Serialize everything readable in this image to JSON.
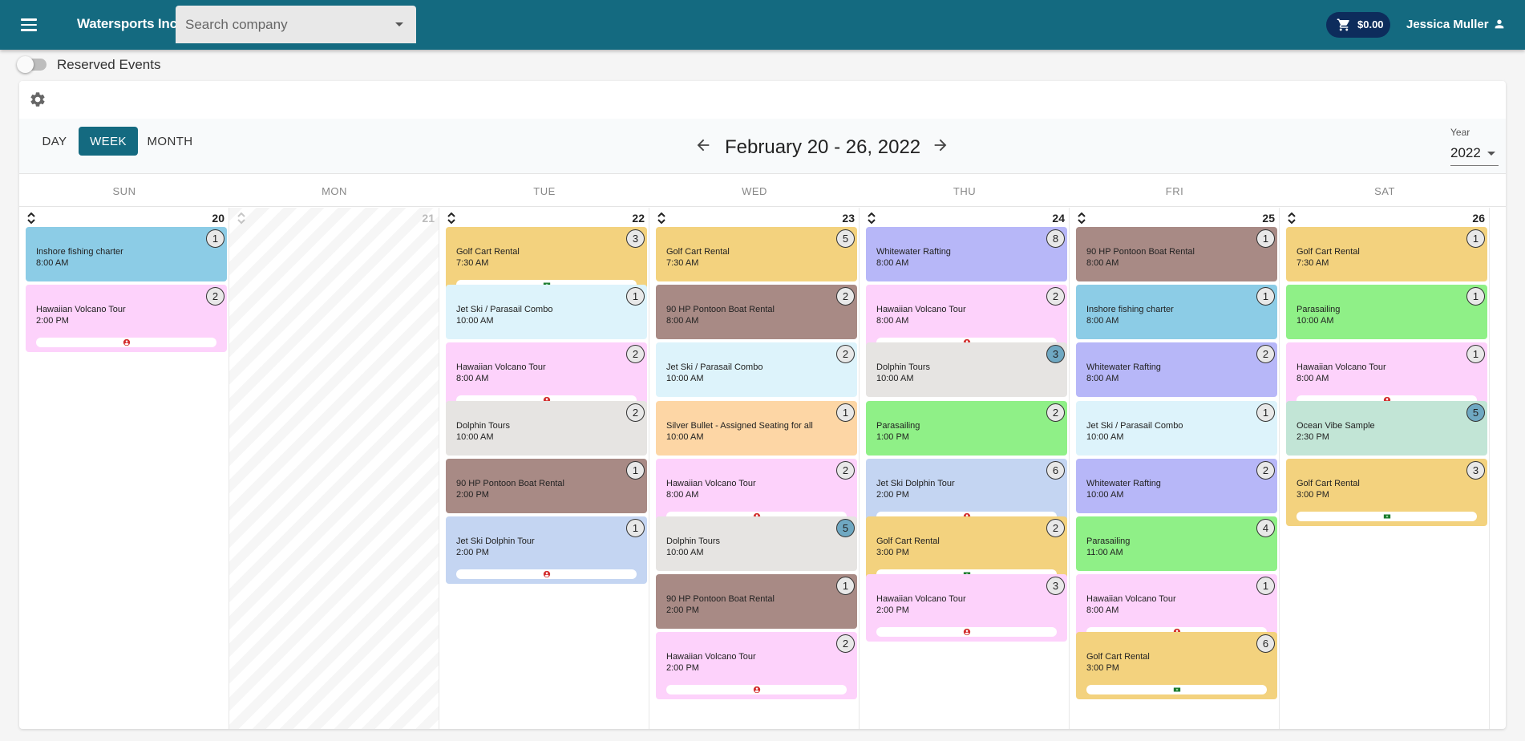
{
  "header": {
    "company": "Watersports Inc.",
    "search_placeholder": "Search company",
    "cart_amount": "$0.00",
    "user_name": "Jessica Muller"
  },
  "toggle": {
    "label": "Reserved Events",
    "on": false
  },
  "toolbar": {
    "views": [
      "DAY",
      "WEEK",
      "MONTH"
    ],
    "active_view": "WEEK",
    "range_title": "February 20 - 26, 2022",
    "year_label": "Year",
    "year_value": "2022"
  },
  "colors": {
    "appbar": "#146a80",
    "golf": "#f3d27e",
    "fishing": "#8ccce6",
    "hawaiian": "#fdd2fb",
    "jetski_parasail": "#ddf3fb",
    "dolphin": "#e6e4e2",
    "pontoon": "#a88a85",
    "jetski_dolphin": "#c4d5f2",
    "rafting": "#b7b7f8",
    "silver": "#fdd6a5",
    "parasailing": "#8ff087",
    "ocean": "#c2e5d6"
  },
  "days": [
    {
      "dow": "SUN",
      "date": "20",
      "disabled": false,
      "events": [
        {
          "title": "Inshore fishing charter",
          "time": "8:00 AM",
          "count": "1",
          "color": "fishing",
          "bar": null
        },
        {
          "title": "Hawaiian Volcano Tour",
          "time": "2:00 PM",
          "count": "2",
          "color": "hawaiian",
          "bar": "person"
        }
      ]
    },
    {
      "dow": "MON",
      "date": "21",
      "disabled": true,
      "events": []
    },
    {
      "dow": "TUE",
      "date": "22",
      "disabled": false,
      "events": [
        {
          "title": "Golf Cart Rental",
          "time": "7:30 AM",
          "count": "3",
          "color": "golf",
          "bar": "cash"
        },
        {
          "title": "Jet Ski / Parasail Combo",
          "time": "10:00 AM",
          "count": "1",
          "color": "jetski_parasail",
          "bar": null
        },
        {
          "title": "Hawaiian Volcano Tour",
          "time": "8:00 AM",
          "count": "2",
          "color": "hawaiian",
          "bar": "person"
        },
        {
          "title": "Dolphin Tours",
          "time": "10:00 AM",
          "count": "2",
          "color": "dolphin",
          "bar": null
        },
        {
          "title": "90 HP Pontoon Boat Rental",
          "time": "2:00 PM",
          "count": "1",
          "color": "pontoon",
          "bar": null
        },
        {
          "title": "Jet Ski Dolphin Tour",
          "time": "2:00 PM",
          "count": "1",
          "color": "jetski_dolphin",
          "bar": "person"
        }
      ]
    },
    {
      "dow": "WED",
      "date": "23",
      "disabled": false,
      "events": [
        {
          "title": "Golf Cart Rental",
          "time": "7:30 AM",
          "count": "5",
          "color": "golf",
          "bar": null
        },
        {
          "title": "90 HP Pontoon Boat Rental",
          "time": "8:00 AM",
          "count": "2",
          "color": "pontoon",
          "bar": null
        },
        {
          "title": "Jet Ski / Parasail Combo",
          "time": "10:00 AM",
          "count": "2",
          "color": "jetski_parasail",
          "bar": null
        },
        {
          "title": "Silver Bullet - Assigned Seating for all",
          "time": "10:00 AM",
          "count": "1",
          "color": "silver",
          "bar": null
        },
        {
          "title": "Hawaiian Volcano Tour",
          "time": "8:00 AM",
          "count": "2",
          "color": "hawaiian",
          "bar": "person"
        },
        {
          "title": "Dolphin Tours",
          "time": "10:00 AM",
          "count": "5",
          "color": "dolphin",
          "bar": null,
          "badge_blue": true
        },
        {
          "title": "90 HP Pontoon Boat Rental",
          "time": "2:00 PM",
          "count": "1",
          "color": "pontoon",
          "bar": null
        },
        {
          "title": "Hawaiian Volcano Tour",
          "time": "2:00 PM",
          "count": "2",
          "color": "hawaiian",
          "bar": "person"
        }
      ]
    },
    {
      "dow": "THU",
      "date": "24",
      "disabled": false,
      "events": [
        {
          "title": "Whitewater Rafting",
          "time": "8:00 AM",
          "count": "8",
          "color": "rafting",
          "bar": null
        },
        {
          "title": "Hawaiian Volcano Tour",
          "time": "8:00 AM",
          "count": "2",
          "color": "hawaiian",
          "bar": "person"
        },
        {
          "title": "Dolphin Tours",
          "time": "10:00 AM",
          "count": "3",
          "color": "dolphin",
          "bar": null,
          "badge_blue": true
        },
        {
          "title": "Parasailing",
          "time": "1:00 PM",
          "count": "2",
          "color": "parasailing",
          "bar": null
        },
        {
          "title": "Jet Ski Dolphin Tour",
          "time": "2:00 PM",
          "count": "6",
          "color": "jetski_dolphin",
          "bar": "person"
        },
        {
          "title": "Golf Cart Rental",
          "time": "3:00 PM",
          "count": "2",
          "color": "golf",
          "bar": "cash"
        },
        {
          "title": "Hawaiian Volcano Tour",
          "time": "2:00 PM",
          "count": "3",
          "color": "hawaiian",
          "bar": "person"
        }
      ]
    },
    {
      "dow": "FRI",
      "date": "25",
      "disabled": false,
      "events": [
        {
          "title": "90 HP Pontoon Boat Rental",
          "time": "8:00 AM",
          "count": "1",
          "color": "pontoon",
          "bar": null
        },
        {
          "title": "Inshore fishing charter",
          "time": "8:00 AM",
          "count": "1",
          "color": "fishing",
          "bar": null
        },
        {
          "title": "Whitewater Rafting",
          "time": "8:00 AM",
          "count": "2",
          "color": "rafting",
          "bar": null
        },
        {
          "title": "Jet Ski / Parasail Combo",
          "time": "10:00 AM",
          "count": "1",
          "color": "jetski_parasail",
          "bar": null
        },
        {
          "title": "Whitewater Rafting",
          "time": "10:00 AM",
          "count": "2",
          "color": "rafting",
          "bar": null
        },
        {
          "title": "Parasailing",
          "time": "11:00 AM",
          "count": "4",
          "color": "parasailing",
          "bar": null
        },
        {
          "title": "Hawaiian Volcano Tour",
          "time": "8:00 AM",
          "count": "1",
          "color": "hawaiian",
          "bar": "person"
        },
        {
          "title": "Golf Cart Rental",
          "time": "3:00 PM",
          "count": "6",
          "color": "golf",
          "bar": "cash"
        }
      ]
    },
    {
      "dow": "SAT",
      "date": "26",
      "disabled": false,
      "events": [
        {
          "title": "Golf Cart Rental",
          "time": "7:30 AM",
          "count": "1",
          "color": "golf",
          "bar": null
        },
        {
          "title": "Parasailing",
          "time": "10:00 AM",
          "count": "1",
          "color": "parasailing",
          "bar": null
        },
        {
          "title": "Hawaiian Volcano Tour",
          "time": "8:00 AM",
          "count": "1",
          "color": "hawaiian",
          "bar": "person"
        },
        {
          "title": "Ocean Vibe Sample",
          "time": "2:30 PM",
          "count": "5",
          "color": "ocean",
          "bar": null,
          "badge_blue": true
        },
        {
          "title": "Golf Cart Rental",
          "time": "3:00 PM",
          "count": "3",
          "color": "golf",
          "bar": "cash"
        }
      ]
    }
  ]
}
